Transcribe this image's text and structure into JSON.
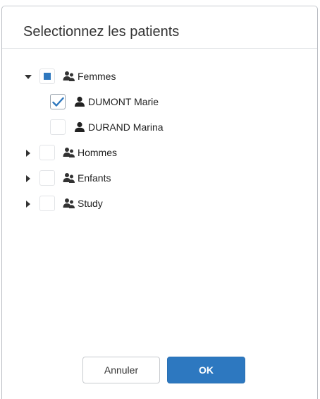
{
  "dialog": {
    "title": "Selectionnez les patients"
  },
  "tree": {
    "groups": [
      {
        "label": "Femmes",
        "expanded": true,
        "state": "indeterminate",
        "children": [
          {
            "label": "DUMONT Marie",
            "checked": true
          },
          {
            "label": "DURAND Marina",
            "checked": false
          }
        ]
      },
      {
        "label": "Hommes",
        "expanded": false,
        "state": "unchecked"
      },
      {
        "label": "Enfants",
        "expanded": false,
        "state": "unchecked"
      },
      {
        "label": "Study",
        "expanded": false,
        "state": "unchecked"
      }
    ]
  },
  "footer": {
    "cancel_label": "Annuler",
    "ok_label": "OK"
  },
  "colors": {
    "accent": "#2d78c0",
    "check": "#2f78be",
    "text": "#222222"
  },
  "icons": {
    "group": "users-icon",
    "patient": "user-icon",
    "expanded": "caret-down-icon",
    "collapsed": "caret-right-icon"
  }
}
